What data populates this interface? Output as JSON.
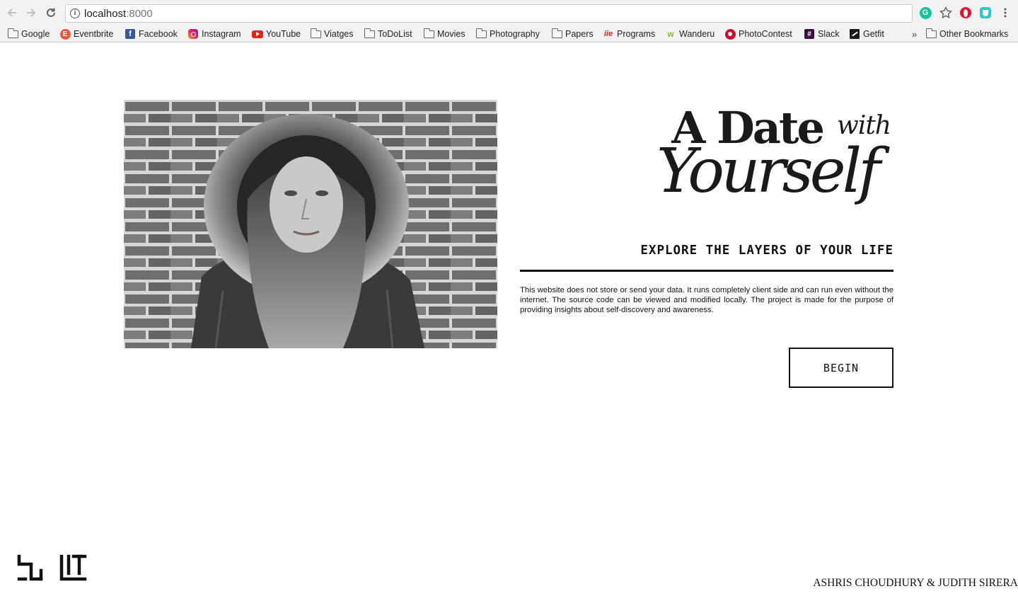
{
  "browser": {
    "url_host": "localhost",
    "url_port": ":8000",
    "bookmarks": [
      {
        "label": "Google",
        "icon": "folder-icon"
      },
      {
        "label": "Eventbrite",
        "icon": "eventbrite-icon"
      },
      {
        "label": "Facebook",
        "icon": "facebook-icon"
      },
      {
        "label": "Instagram",
        "icon": "instagram-icon"
      },
      {
        "label": "YouTube",
        "icon": "youtube-icon"
      },
      {
        "label": "Viatges",
        "icon": "folder-icon"
      },
      {
        "label": "ToDoList",
        "icon": "folder-icon"
      },
      {
        "label": "Movies",
        "icon": "folder-icon"
      },
      {
        "label": "Photography",
        "icon": "folder-icon"
      },
      {
        "label": "Papers",
        "icon": "folder-icon"
      },
      {
        "label": "Programs",
        "icon": "iie-icon"
      },
      {
        "label": "Wanderu",
        "icon": "wanderu-icon"
      },
      {
        "label": "PhotoContest",
        "icon": "photocontest-icon"
      },
      {
        "label": "Slack",
        "icon": "slack-icon"
      },
      {
        "label": "Getfit",
        "icon": "getfit-icon"
      }
    ],
    "overflow_label": "»",
    "other_bookmarks": "Other Bookmarks"
  },
  "page": {
    "title_a_date": "A Date",
    "title_with": "with",
    "title_yourself": "Yourself",
    "tagline": "EXPLORE THE LAYERS OF YOUR LIFE",
    "disclaimer": "This website does not store or send your data. It runs completely client side and can run even without the internet. The source code can be viewed and modified locally. The project is made for the purpose of providing insights about self-discovery and awareness.",
    "begin_label": "BEGIN",
    "credits": "ASHRIS CHOUDHURY & JUDITH SIRERA"
  },
  "colors": {
    "text": "#111111",
    "background": "#ffffff",
    "chrome": "#f2f2f2"
  }
}
